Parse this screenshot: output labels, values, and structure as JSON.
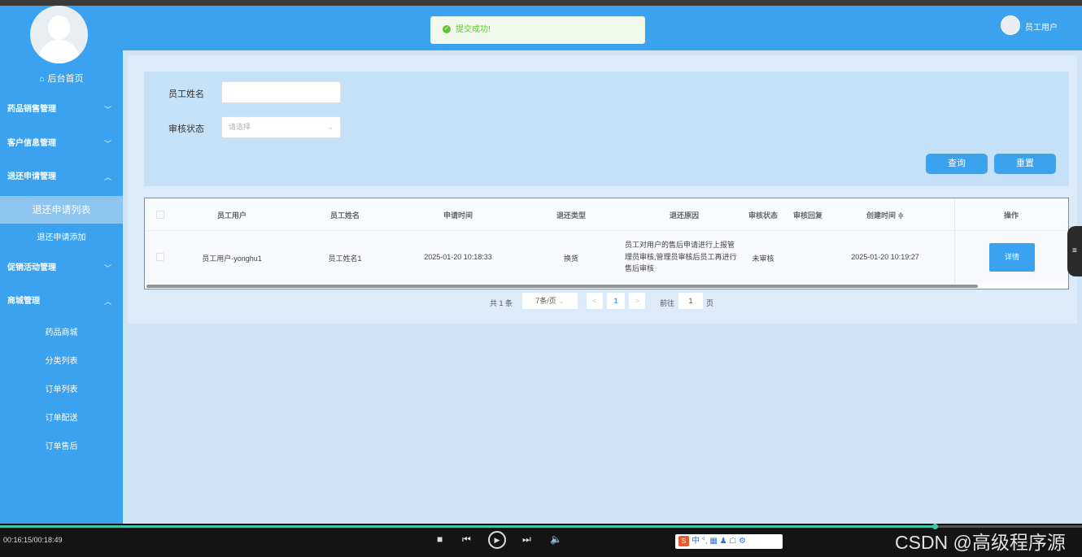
{
  "sidebar": {
    "home": "后台首页",
    "menu": [
      {
        "label": "药品销售管理",
        "chevron": "﹀"
      },
      {
        "label": "客户信息管理",
        "chevron": "﹀"
      },
      {
        "label": "退还申请管理",
        "chevron": "︿"
      },
      {
        "label": "促销活动管理",
        "chevron": "﹀"
      },
      {
        "label": "商城管理",
        "chevron": "︿"
      }
    ],
    "return_sub": [
      "退还申请列表",
      "退还申请添加"
    ],
    "mall_sub": [
      "药品商城",
      "分类列表",
      "订单列表",
      "订单配送",
      "订单售后"
    ]
  },
  "header": {
    "toast": "提交成功!",
    "user": "员工用户"
  },
  "search": {
    "name_label": "员工姓名",
    "name_value": "",
    "status_label": "审核状态",
    "status_placeholder": "请选择",
    "query_btn": "查询",
    "reset_btn": "重置"
  },
  "table": {
    "headers": [
      "员工用户",
      "员工姓名",
      "申请时间",
      "退还类型",
      "退还原因",
      "审核状态",
      "审核回复",
      "创建时间 ≑",
      "操作"
    ],
    "rows": [
      {
        "user": "员工用户-yonghu1",
        "name": "员工姓名1",
        "apply_time": "2025-01-20 10:18:33",
        "type": "换货",
        "reason": "员工对用户的售后申请进行上报管理员审核,管理员审核后员工再进行售后审核",
        "status": "未审核",
        "reply": "",
        "created": "2025-01-20 10:19:27",
        "action": "详情"
      }
    ]
  },
  "pagination": {
    "total": "共 1 条",
    "page_size": "7条/页",
    "prev": "<",
    "current": "1",
    "next": ">",
    "goto_label": "前往",
    "goto_value": "1",
    "page_unit": "页"
  },
  "player": {
    "time": "00:16:15/00:18:49",
    "progress": 0.864,
    "ime_label": "中",
    "watermark": "CSDN @高级程序源"
  },
  "colors": {
    "primary": "#3aa2ef",
    "success": "#67c23a"
  }
}
